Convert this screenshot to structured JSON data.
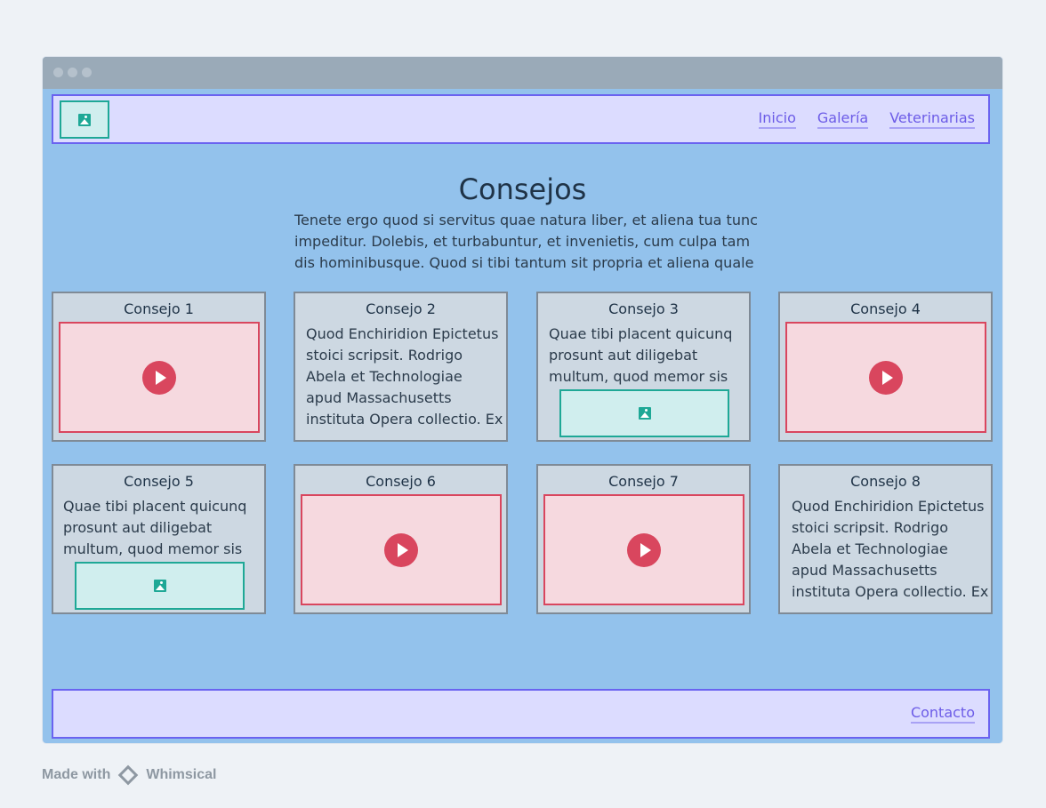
{
  "header": {
    "logo_icon": "image-icon",
    "nav": [
      "Inicio",
      "Galería",
      "Veterinarias"
    ]
  },
  "main": {
    "title": "Consejos",
    "intro_lines": [
      "Tenete ergo quod si servitus quae natura liber, et aliena tua tunc",
      "impeditur. Dolebis, et turbabuntur, et invenietis, cum culpa tam",
      "dis hominibusque. Quod si tibi tantum sit propria et aliena quale"
    ],
    "cards": [
      {
        "title": "Consejo 1",
        "type": "video"
      },
      {
        "title": "Consejo 2",
        "type": "text",
        "lines": [
          "Quod Enchiridion Epictetus",
          "stoici scripsit. Rodrigo",
          "Abela et Technologiae",
          "apud Massachusetts",
          "instituta Opera collectio. Ex"
        ]
      },
      {
        "title": "Consejo 3",
        "type": "text-image",
        "lines": [
          "Quae tibi placent quicunq",
          "prosunt aut diligebat",
          "multum, quod memor sis"
        ]
      },
      {
        "title": "Consejo 4",
        "type": "video"
      },
      {
        "title": "Consejo 5",
        "type": "text-image",
        "lines": [
          "Quae tibi placent quicunq",
          "prosunt aut diligebat",
          "multum, quod memor sis"
        ]
      },
      {
        "title": "Consejo 6",
        "type": "video"
      },
      {
        "title": "Consejo 7",
        "type": "video"
      },
      {
        "title": "Consejo 8",
        "type": "text",
        "lines": [
          "Quod Enchiridion Epictetus",
          "stoici scripsit. Rodrigo",
          "Abela et Technologiae",
          "apud Massachusetts",
          "instituta Opera collectio. Ex"
        ]
      }
    ]
  },
  "footer": {
    "link": "Contacto"
  },
  "watermark": {
    "made_with": "Made with",
    "brand": "Whimsical"
  },
  "colors": {
    "background": "#93c2ec",
    "header_bg": "#dcdcff",
    "header_border": "#6a63f0",
    "link": "#6c5ce7",
    "card_bg": "#cdd8e2",
    "video_bg": "#f6d9df",
    "video_accent": "#d9465e",
    "image_accent": "#1ea896"
  }
}
